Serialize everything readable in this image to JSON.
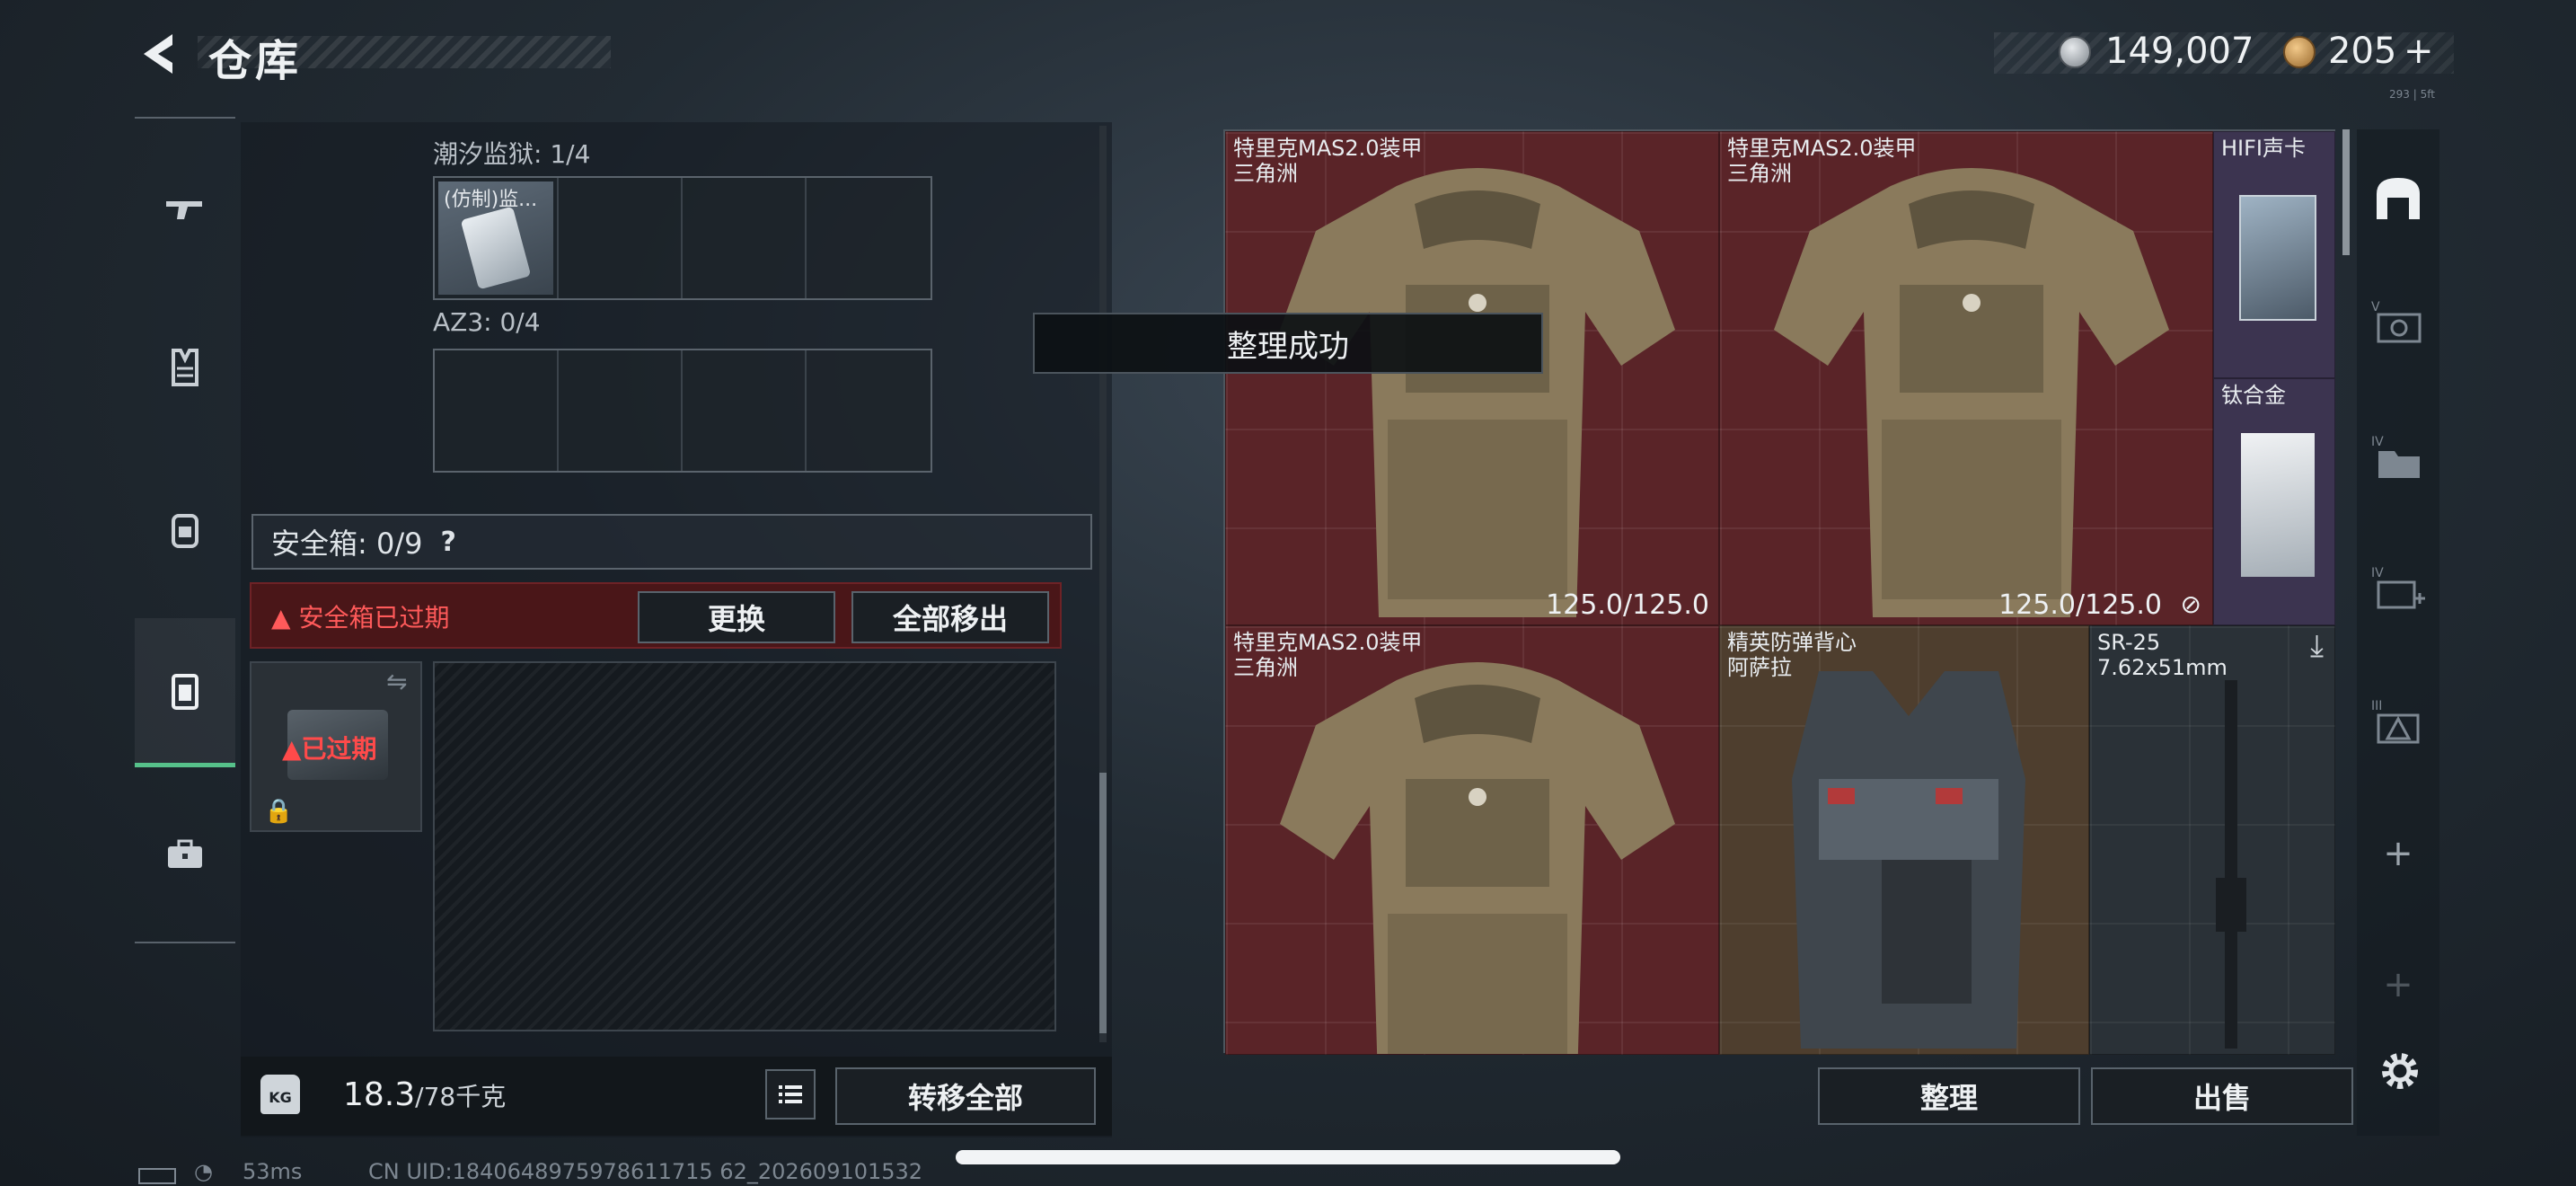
{
  "header": {
    "title": "仓库"
  },
  "currency": {
    "silver": "149,007",
    "gold": "205",
    "gold_suffix": "+"
  },
  "top_small_text": "293 | 5ft",
  "left_rail": {
    "items": [
      "weapon",
      "vest",
      "backpack",
      "safe-box",
      "briefcase"
    ]
  },
  "left_panel": {
    "container1": {
      "label": "潮汐监狱: 1/4",
      "item_label": "(仿制)监..."
    },
    "container2": {
      "label": "AZ3: 0/4"
    },
    "safe_box": {
      "label": "安全箱: 0/9",
      "help": "?",
      "expired_banner": "安全箱已过期",
      "replace_button": "更换",
      "remove_all_button": "全部移出",
      "thumb_status": "已过期"
    },
    "footer": {
      "weight_value": "18.3",
      "weight_max": "/78千克",
      "transfer_all_button": "转移全部"
    }
  },
  "toast": "整理成功",
  "stash": {
    "tiles": [
      {
        "name": "特里克MAS2.0装甲",
        "sub": "三角洲",
        "durability": "125.0/125.0"
      },
      {
        "name": "特里克MAS2.0装甲",
        "sub": "三角洲",
        "durability": "125.0/125.0"
      },
      {
        "name": "HIFI声卡",
        "sub": ""
      },
      {
        "name": "钛合金",
        "sub": ""
      },
      {
        "name": "特里克MAS2.0装甲",
        "sub": "三角洲",
        "durability": ""
      },
      {
        "name": "精英防弹背心",
        "sub": "阿萨拉",
        "durability": ""
      },
      {
        "name": "SR-25",
        "sub": "7.62x51mm"
      }
    ],
    "organize_button": "整理",
    "sell_button": "出售"
  },
  "right_rail": {
    "items": [
      "home-vault",
      "IV-camera",
      "IV-folder",
      "IV-medical",
      "III-warning",
      "+",
      "+"
    ],
    "add_symbol": "+"
  },
  "status_bar": {
    "ping": "53ms",
    "uid": "CN UID:1840648975978611715 62_202609101532"
  }
}
